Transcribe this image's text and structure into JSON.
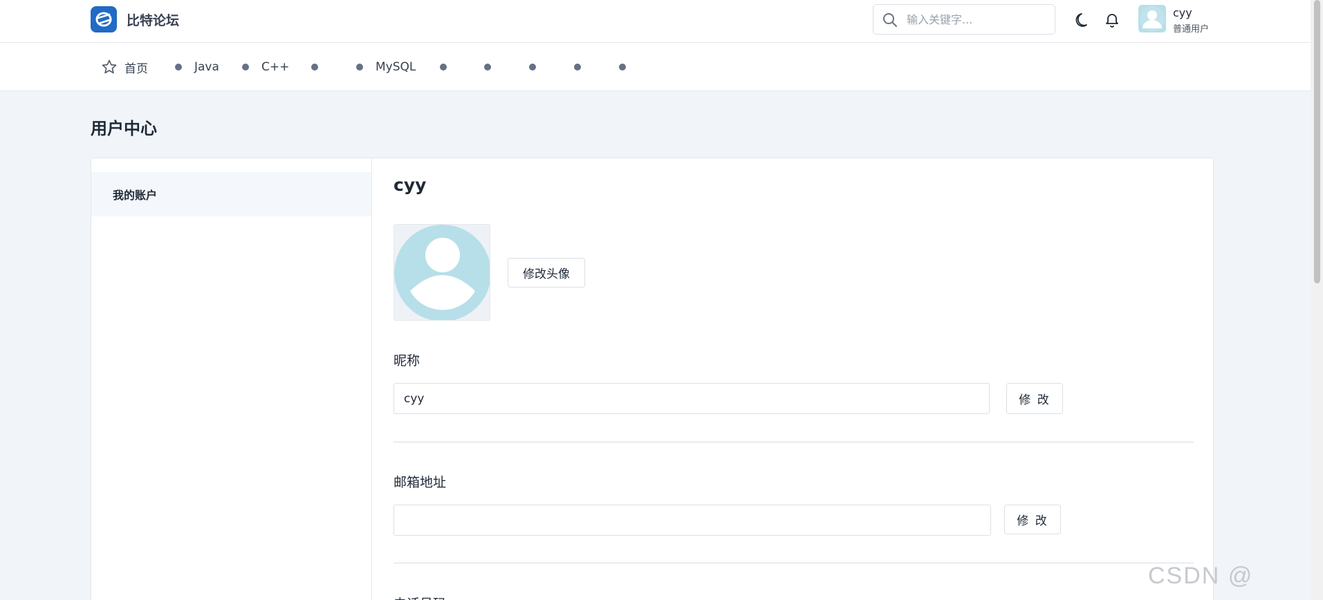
{
  "header": {
    "brand": "比特论坛",
    "search_placeholder": "输入关键字...",
    "user": {
      "name": "cyy",
      "role": "普通用户"
    }
  },
  "nav": {
    "home_label": "首页",
    "boards": [
      "Java",
      "C++",
      "",
      "MySQL",
      "",
      "",
      "",
      "",
      ""
    ]
  },
  "page": {
    "title": "用户中心"
  },
  "sidebar": {
    "items": [
      {
        "label": "我的账户"
      }
    ]
  },
  "account": {
    "name": "cyy",
    "change_avatar_label": "修改头像",
    "nickname": {
      "label": "昵称",
      "value": "cyy",
      "button": "修 改"
    },
    "email": {
      "label": "邮箱地址",
      "value": "",
      "button": "修 改"
    },
    "phone": {
      "label": "电话号码"
    }
  },
  "watermark": "CSDN @",
  "colors": {
    "accent": "#206bc4",
    "avatar_bg": "#b7dfe9",
    "dot": "#667085"
  }
}
